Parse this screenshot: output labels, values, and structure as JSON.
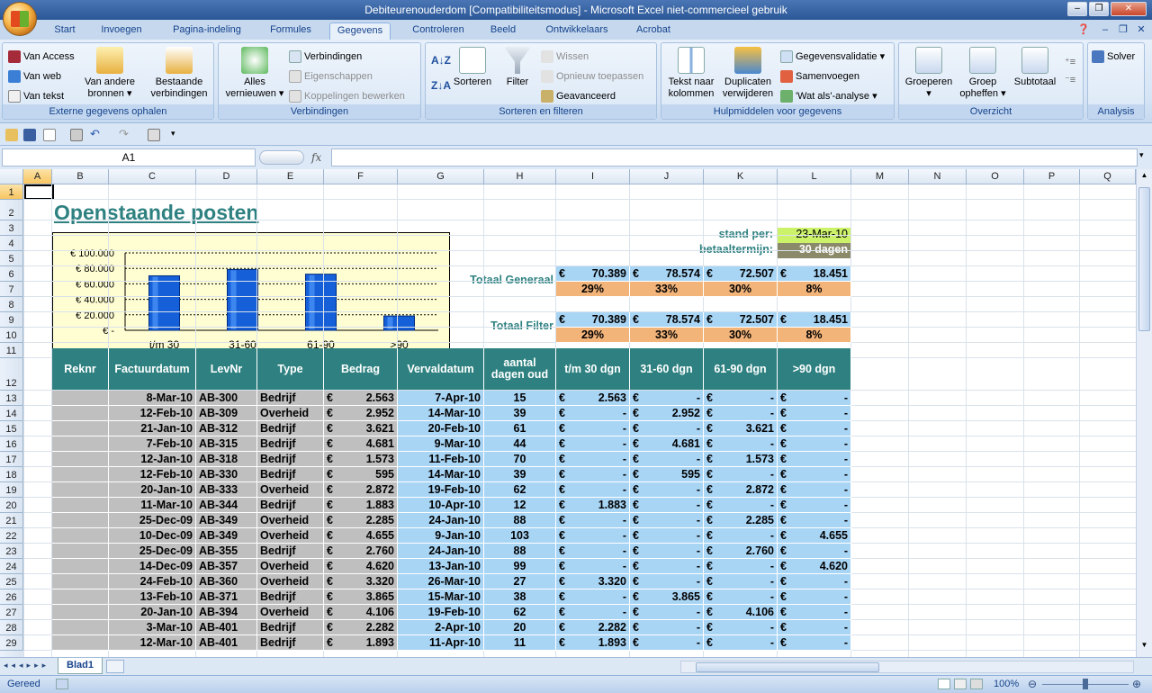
{
  "window": {
    "title": "Debiteurenouderdom  [Compatibiliteitsmodus] - Microsoft Excel niet-commercieel gebruik"
  },
  "tabs": [
    "Start",
    "Invoegen",
    "Pagina-indeling",
    "Formules",
    "Gegevens",
    "Controleren",
    "Beeld",
    "Ontwikkelaars",
    "Acrobat"
  ],
  "active_tab": "Gegevens",
  "ribbon": {
    "ext": {
      "access": "Van Access",
      "web": "Van web",
      "text": "Van tekst",
      "other1": "Van andere",
      "other2": "bronnen",
      "existing1": "Bestaande",
      "existing2": "verbindingen",
      "caption": "Externe gegevens ophalen"
    },
    "conn": {
      "refresh1": "Alles",
      "refresh2": "vernieuwen",
      "connections": "Verbindingen",
      "properties": "Eigenschappen",
      "editlinks": "Koppelingen bewerken",
      "caption": "Verbindingen"
    },
    "sort": {
      "sort": "Sorteren",
      "filter": "Filter",
      "clear": "Wissen",
      "reapply": "Opnieuw toepassen",
      "advanced": "Geavanceerd",
      "caption": "Sorteren en filteren"
    },
    "tools": {
      "ttc1": "Tekst naar",
      "ttc2": "kolommen",
      "dup1": "Duplicaten",
      "dup2": "verwijderen",
      "validation": "Gegevensvalidatie",
      "consolidate": "Samenvoegen",
      "whatif": "'Wat als'-analyse",
      "caption": "Hulpmiddelen voor gegevens"
    },
    "outline": {
      "group": "Groeperen",
      "ungroup1": "Groep",
      "ungroup2": "opheffen",
      "subtotal": "Subtotaal",
      "caption": "Overzicht"
    },
    "analysis": {
      "solver": "Solver",
      "caption": "Analysis"
    }
  },
  "namebox": "A1",
  "fx": "fx",
  "formula": "",
  "columns": [
    "A",
    "B",
    "C",
    "D",
    "E",
    "F",
    "G",
    "H",
    "I",
    "J",
    "K",
    "L",
    "M",
    "N",
    "O",
    "P",
    "Q"
  ],
  "rows": [
    "1",
    "2",
    "3",
    "4",
    "5",
    "6",
    "7",
    "8",
    "9",
    "10",
    "11",
    "12",
    "13",
    "14",
    "15",
    "16",
    "17",
    "18",
    "19",
    "20",
    "21",
    "22",
    "23",
    "24",
    "25",
    "26",
    "27",
    "28",
    "29"
  ],
  "sheet": {
    "title": "Openstaande posten",
    "stand_label": "stand per:",
    "stand_value": "23-Mar-10",
    "term_label": "betaaltermijn:",
    "term_value": "30 dagen",
    "total_label": "Totaal Generaal",
    "filter_label": "Totaal Filter",
    "totals": [
      "70.389",
      "78.574",
      "72.507",
      "18.451"
    ],
    "pcts": [
      "29%",
      "33%",
      "30%",
      "8%"
    ],
    "filter_totals": [
      "70.389",
      "78.574",
      "72.507",
      "18.451"
    ],
    "filter_pcts": [
      "29%",
      "33%",
      "30%",
      "8%"
    ],
    "euro": "€",
    "headers": [
      "Reknr",
      "Factuurdatum",
      "LevNr",
      "Type",
      "Bedrag",
      "Vervaldatum",
      "aantal dagen oud",
      "t/m 30 dgn",
      "31-60 dgn",
      "61-90 dgn",
      ">90 dgn"
    ],
    "data": [
      [
        "8-Mar-10",
        "AB-300",
        "Bedrijf",
        "2.563",
        "7-Apr-10",
        "15",
        "2.563",
        "-",
        "-",
        "-"
      ],
      [
        "12-Feb-10",
        "AB-309",
        "Overheid",
        "2.952",
        "14-Mar-10",
        "39",
        "-",
        "2.952",
        "-",
        "-"
      ],
      [
        "21-Jan-10",
        "AB-312",
        "Bedrijf",
        "3.621",
        "20-Feb-10",
        "61",
        "-",
        "-",
        "3.621",
        "-"
      ],
      [
        "7-Feb-10",
        "AB-315",
        "Bedrijf",
        "4.681",
        "9-Mar-10",
        "44",
        "-",
        "4.681",
        "-",
        "-"
      ],
      [
        "12-Jan-10",
        "AB-318",
        "Bedrijf",
        "1.573",
        "11-Feb-10",
        "70",
        "-",
        "-",
        "1.573",
        "-"
      ],
      [
        "12-Feb-10",
        "AB-330",
        "Bedrijf",
        "595",
        "14-Mar-10",
        "39",
        "-",
        "595",
        "-",
        "-"
      ],
      [
        "20-Jan-10",
        "AB-333",
        "Overheid",
        "2.872",
        "19-Feb-10",
        "62",
        "-",
        "-",
        "2.872",
        "-"
      ],
      [
        "11-Mar-10",
        "AB-344",
        "Bedrijf",
        "1.883",
        "10-Apr-10",
        "12",
        "1.883",
        "-",
        "-",
        "-"
      ],
      [
        "25-Dec-09",
        "AB-349",
        "Overheid",
        "2.285",
        "24-Jan-10",
        "88",
        "-",
        "-",
        "2.285",
        "-"
      ],
      [
        "10-Dec-09",
        "AB-349",
        "Overheid",
        "4.655",
        "9-Jan-10",
        "103",
        "-",
        "-",
        "-",
        "4.655"
      ],
      [
        "25-Dec-09",
        "AB-355",
        "Bedrijf",
        "2.760",
        "24-Jan-10",
        "88",
        "-",
        "-",
        "2.760",
        "-"
      ],
      [
        "14-Dec-09",
        "AB-357",
        "Overheid",
        "4.620",
        "13-Jan-10",
        "99",
        "-",
        "-",
        "-",
        "4.620"
      ],
      [
        "24-Feb-10",
        "AB-360",
        "Overheid",
        "3.320",
        "26-Mar-10",
        "27",
        "3.320",
        "-",
        "-",
        "-"
      ],
      [
        "13-Feb-10",
        "AB-371",
        "Bedrijf",
        "3.865",
        "15-Mar-10",
        "38",
        "-",
        "3.865",
        "-",
        "-"
      ],
      [
        "20-Jan-10",
        "AB-394",
        "Overheid",
        "4.106",
        "19-Feb-10",
        "62",
        "-",
        "-",
        "4.106",
        "-"
      ],
      [
        "3-Mar-10",
        "AB-401",
        "Bedrijf",
        "2.282",
        "2-Apr-10",
        "20",
        "2.282",
        "-",
        "-",
        "-"
      ],
      [
        "12-Mar-10",
        "AB-401",
        "Bedrijf",
        "1.893",
        "11-Apr-10",
        "11",
        "1.893",
        "-",
        "-",
        "-"
      ]
    ]
  },
  "chart_data": {
    "type": "bar",
    "categories": [
      "t/m 30",
      "31-60",
      "61-90",
      ">90"
    ],
    "values": [
      70389,
      78574,
      72507,
      18451
    ],
    "ylim": [
      0,
      100000
    ],
    "yticks": [
      "€ 100.000",
      "€ 80.000",
      "€ 60.000",
      "€ 40.000",
      "€ 20.000",
      "€ -"
    ],
    "grid": true,
    "bar_color": "#1560d8"
  },
  "sheettab": "Blad1",
  "status": {
    "ready": "Gereed",
    "zoom": "100%"
  }
}
